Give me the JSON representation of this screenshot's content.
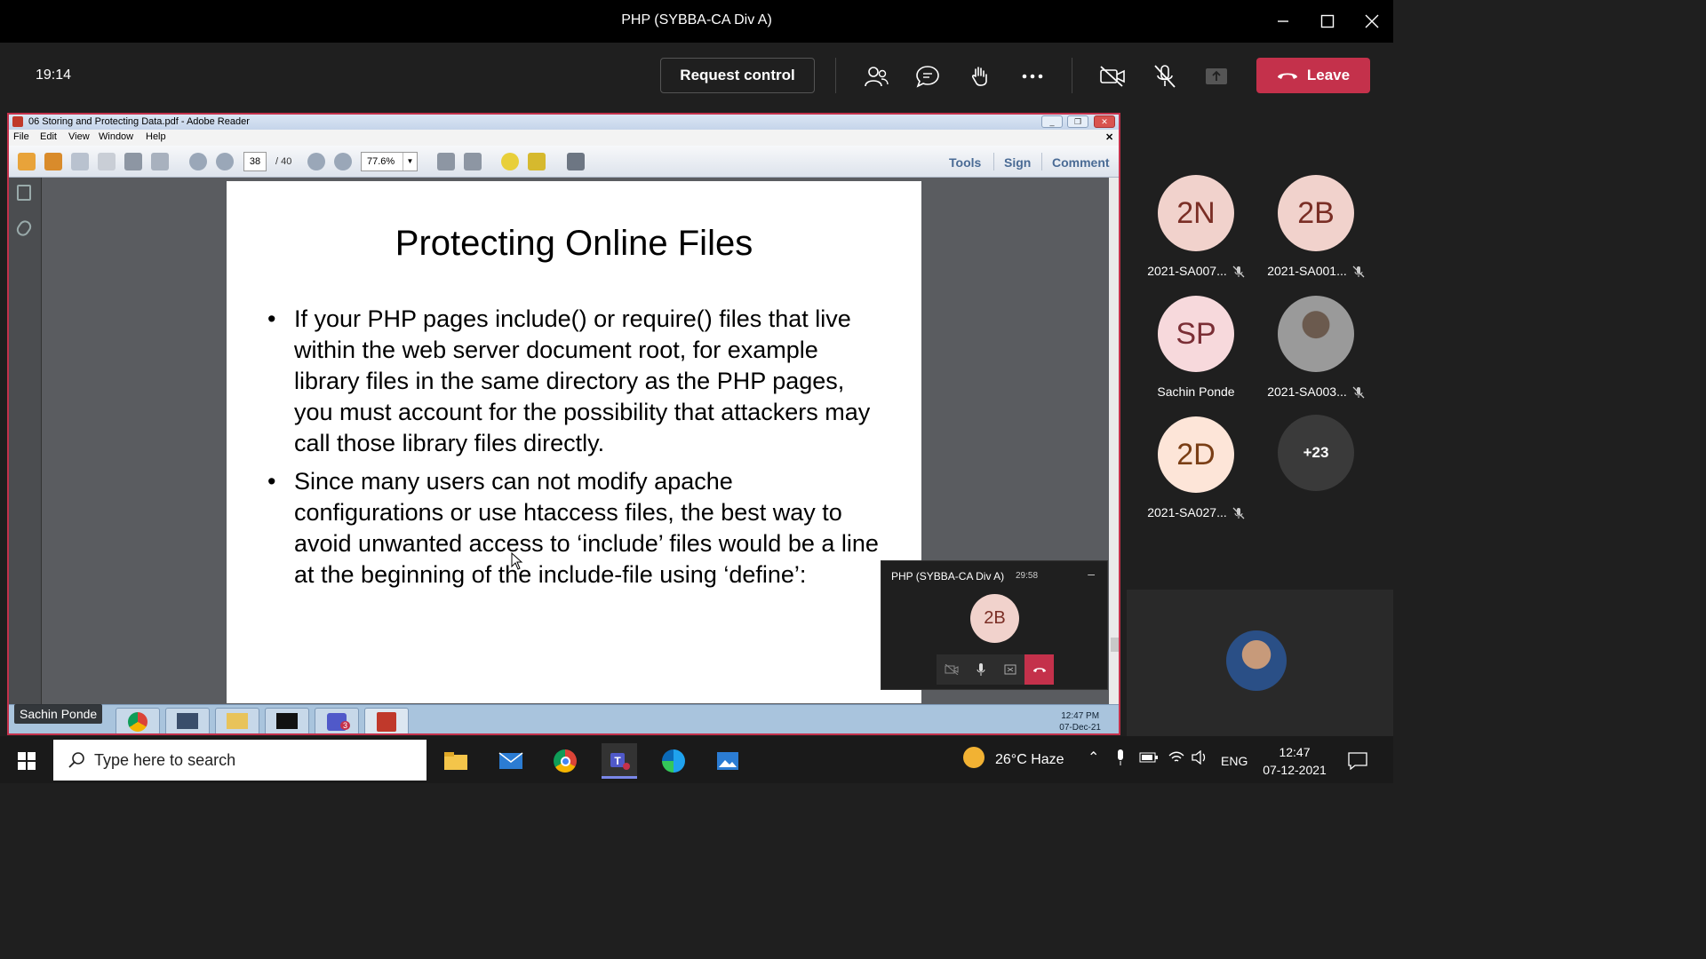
{
  "window": {
    "title": "PHP (SYBBA-CA Div A)"
  },
  "meeting_bar": {
    "time": "19:14",
    "request_control_label": "Request control",
    "leave_label": "Leave",
    "icons": [
      "people-icon",
      "chat-icon",
      "raise-hand-icon",
      "more-icon",
      "camera-off-icon",
      "mic-off-icon",
      "share-tray-icon"
    ]
  },
  "reader": {
    "title": "06 Storing and Protecting Data.pdf - Adobe Reader",
    "menu": [
      "File",
      "Edit",
      "View",
      "Window",
      "Help"
    ],
    "page_current": "38",
    "page_total": "/ 40",
    "zoom": "77.6%",
    "right_tabs": [
      "Tools",
      "Sign",
      "Comment"
    ],
    "slide": {
      "title": "Protecting Online Files",
      "bullets": [
        "If your PHP pages include() or require() files that live within the web server document root, for example library files in the same directory as the PHP pages, you must account for the possibility that attackers may call those library files directly.",
        "Since many users can not modify apache configurations or use htaccess files, the best way to avoid unwanted access to ‘include’ files would be a line at the beginning of the include-file using ‘define’:"
      ]
    },
    "remote_taskbar": {
      "time": "12:47 PM",
      "date": "07-Dec-21",
      "teams_badge": "3"
    },
    "presenter_name": "Sachin Ponde"
  },
  "mini_call": {
    "title": "PHP (SYBBA-CA Div A)",
    "duration": "29:58",
    "avatar_initials": "2B",
    "minimize": "–"
  },
  "participants": [
    {
      "initials": "2N",
      "name": "2021-SA007...",
      "muted": true,
      "bg": "#f1d2cc",
      "fg": "#7a2e25"
    },
    {
      "initials": "2B",
      "name": "2021-SA001...",
      "muted": true,
      "bg": "#f1d2cc",
      "fg": "#7a2e25"
    },
    {
      "initials": "SP",
      "name": "Sachin Ponde",
      "muted": false,
      "bg": "#f7d9dc",
      "fg": "#7a2e35"
    },
    {
      "initials": "",
      "name": "2021-SA003...",
      "muted": true,
      "bg": "#888888",
      "fg": "#ffffff"
    },
    {
      "initials": "2D",
      "name": "2021-SA027...",
      "muted": true,
      "bg": "#fde5d8",
      "fg": "#7a3e15"
    },
    {
      "initials": "+23",
      "name": "",
      "muted": false,
      "bg": "#3a3a3a",
      "fg": "#ffffff"
    }
  ],
  "windows_taskbar": {
    "search_placeholder": "Type here to search",
    "weather": "26°C  Haze",
    "language": "ENG",
    "time": "12:47",
    "date": "07-12-2021"
  }
}
